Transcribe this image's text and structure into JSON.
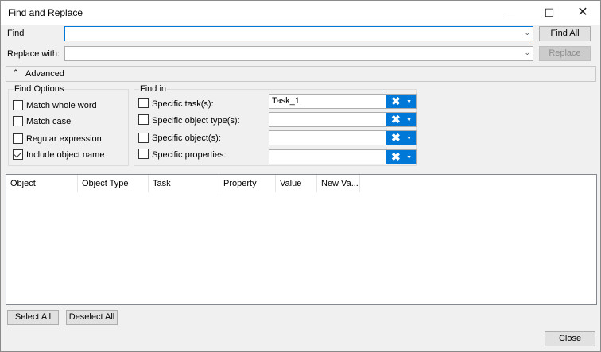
{
  "window": {
    "title": "Find and Replace",
    "minimize_icon": "minimize-icon",
    "maximize_icon": "maximize-icon",
    "close_icon": "close-icon"
  },
  "find": {
    "label": "Find",
    "value": "",
    "find_all": "Find All"
  },
  "replace": {
    "label": "Replace with:",
    "value": "",
    "button": "Replace"
  },
  "advanced": {
    "label": "Advanced",
    "icon": "double-chevron-up-icon"
  },
  "find_options": {
    "title": "Find Options",
    "items": [
      {
        "label": "Match whole word",
        "checked": false
      },
      {
        "label": "Match case",
        "checked": false
      },
      {
        "label": "Regular expression",
        "checked": false
      },
      {
        "label": "Include object name",
        "checked": true
      }
    ]
  },
  "find_in": {
    "title": "Find in",
    "items": [
      {
        "label": "Specific task(s):",
        "checked": false,
        "value": "Task_1"
      },
      {
        "label": "Specific object type(s):",
        "checked": false,
        "value": ""
      },
      {
        "label": "Specific object(s):",
        "checked": false,
        "value": ""
      },
      {
        "label": "Specific properties:",
        "checked": false,
        "value": ""
      }
    ]
  },
  "results": {
    "columns": [
      "Object",
      "Object Type",
      "Task",
      "Property",
      "Value",
      "New Va..."
    ]
  },
  "buttons": {
    "select_all": "Select All",
    "deselect_all": "Deselect All",
    "close": "Close"
  },
  "colors": {
    "accent": "#0078d7"
  }
}
